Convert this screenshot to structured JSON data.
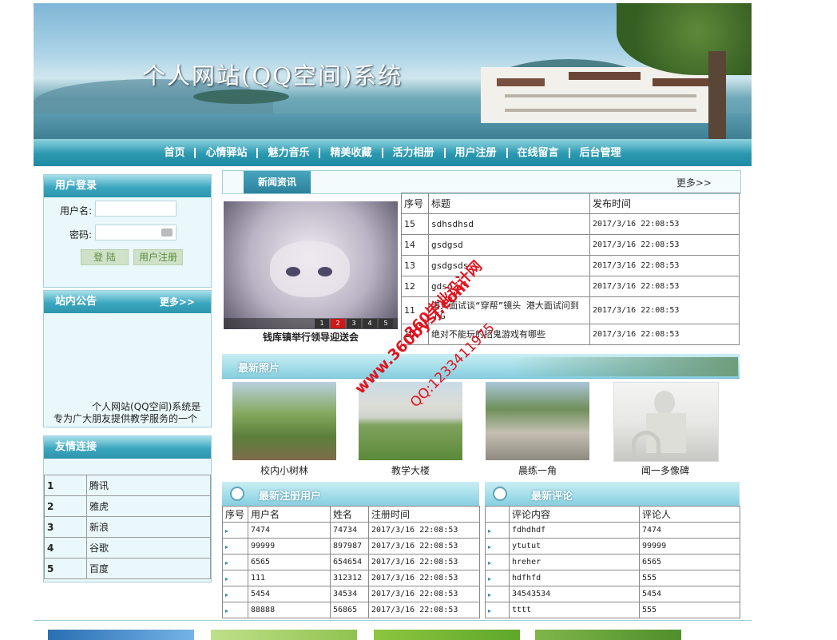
{
  "banner": {
    "title": "个人网站(QQ空间)系统"
  },
  "nav": [
    "首页",
    "心情驿站",
    "魅力音乐",
    "精美收藏",
    "活力相册",
    "用户注册",
    "在线留言",
    "后台管理"
  ],
  "login": {
    "title": "用户登录",
    "username_label": "用户名:",
    "password_label": "密码:",
    "login_button": "登 陆",
    "register_button": "用户注册"
  },
  "notice": {
    "title": "站内公告",
    "more": "更多>>",
    "text": "个人网站(QQ空间)系统是专为广大朋友提供教学服务的一个"
  },
  "friend_links": {
    "title": "友情连接",
    "rows": [
      {
        "no": "1",
        "name": "腾讯"
      },
      {
        "no": "2",
        "name": "雅虎"
      },
      {
        "no": "3",
        "name": "新浪"
      },
      {
        "no": "4",
        "name": "谷歌"
      },
      {
        "no": "5",
        "name": "百度"
      }
    ]
  },
  "news": {
    "tab": "新闻资讯",
    "more": "更多>>",
    "slider_caption": "钱库镇举行领导迎送会",
    "slider_pages": [
      "1",
      "2",
      "3",
      "4",
      "5"
    ],
    "headers": [
      "序号",
      "标题",
      "发布时间"
    ],
    "rows": [
      {
        "no": "15",
        "title": "sdhsdhsd",
        "time": "2017/3/16 22:08:53"
      },
      {
        "no": "14",
        "title": "gsdgsd",
        "time": "2017/3/16 22:08:53"
      },
      {
        "no": "13",
        "title": "gsdgsds",
        "time": "2017/3/16 22:08:53"
      },
      {
        "no": "12",
        "title": "gdsg",
        "time": "2017/3/16 22:08:53"
      },
      {
        "no": "11",
        "title": "港大面试谈“穿帮”镜头 港大面试问到了G",
        "time": "2017/3/16 22:08:53"
      },
      {
        "no": "10",
        "title": "绝对不能玩的招鬼游戏有哪些",
        "time": "2017/3/16 22:08:53"
      }
    ]
  },
  "photos": {
    "title": "最新照片",
    "items": [
      {
        "caption": "校内小树林"
      },
      {
        "caption": "教学大楼"
      },
      {
        "caption": "晨练一角"
      },
      {
        "caption": "闻一多像碑"
      }
    ]
  },
  "users": {
    "title": "最新注册用户",
    "headers": [
      "序号",
      "用户名",
      "姓名",
      "注册时间"
    ],
    "rows": [
      {
        "user": "7474",
        "name": "74734",
        "time": "2017/3/16 22:08:53"
      },
      {
        "user": "99999",
        "name": "897987",
        "time": "2017/3/16 22:08:53"
      },
      {
        "user": "6565",
        "name": "654654",
        "time": "2017/3/16 22:08:53"
      },
      {
        "user": "111",
        "name": "312312",
        "time": "2017/3/16 22:08:53"
      },
      {
        "user": "5454",
        "name": "34534",
        "time": "2017/3/16 22:08:53"
      },
      {
        "user": "88888",
        "name": "56865",
        "time": "2017/3/16 22:08:53"
      }
    ]
  },
  "comments": {
    "title": "最新评论",
    "headers": [
      "评论内容",
      "评论人"
    ],
    "rows": [
      {
        "content": "fdhdhdf",
        "author": "7474"
      },
      {
        "content": "ytutut",
        "author": "99999"
      },
      {
        "content": "hreher",
        "author": "6565"
      },
      {
        "content": "hdfhfd",
        "author": "555"
      },
      {
        "content": "34543534",
        "author": "5454"
      },
      {
        "content": "tttt",
        "author": "555"
      }
    ]
  },
  "watermark": {
    "line1": "360毕业设计网",
    "line2": "www.360bysj.com",
    "line3": "QQ:1233411975"
  }
}
